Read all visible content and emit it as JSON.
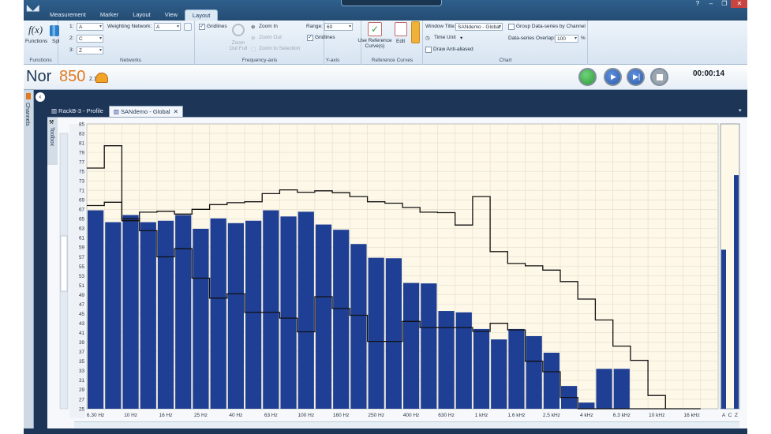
{
  "app": {
    "menu": [
      "Measurement",
      "Marker",
      "Layout",
      "View",
      "Layout"
    ],
    "active_menu_index": 4
  },
  "ribbon": {
    "functions": {
      "fx_label": "Functions",
      "spl_label": "Spl",
      "group_label": "Functions"
    },
    "networks": {
      "rows": [
        {
          "index": "1:",
          "value": "A"
        },
        {
          "index": "2:",
          "value": "C"
        },
        {
          "index": "3:",
          "value": "Z"
        }
      ],
      "weighting_label": "Weighting Network:",
      "weighting_value": "A",
      "group_label": "Networks"
    },
    "frequency_axis": {
      "gridlines_label": "Gridlines",
      "gridlines_checked": true,
      "zoom_out_full": "Zoom Out Full",
      "zoom_in": "Zoom In",
      "zoom_out": "Zoom Out",
      "zoom_to_selection": "Zoom to Selection",
      "group_label": "Frequency-axis"
    },
    "y_axis": {
      "range_label": "Range:",
      "range_value": "60",
      "gridlines_label": "Gridlines",
      "gridlines_checked": true,
      "group_label": "Y-axis"
    },
    "reference_curves": {
      "use_label": "Use Reference Curve(s)",
      "edit_label": "Edit",
      "group_label": "Reference Curves"
    },
    "chart": {
      "window_title_label": "Window Title:",
      "window_title_value": "SANdemo - Global",
      "time_unit_label": "Time Unit",
      "anti_aliased_label": "Draw Anti-aliased",
      "anti_aliased_checked": false,
      "group_by_channel_label": "Group Data-series by Channel",
      "group_by_channel_checked": false,
      "overlap_label": "Data-series Overlap:",
      "overlap_value": "100",
      "overlap_unit": "%",
      "group_label": "Chart"
    }
  },
  "header": {
    "brand_name": "Nor",
    "brand_number": "850",
    "brand_version": "2.1",
    "elapsed": "00:00:14",
    "colors": {
      "record": "#2e9b3a",
      "control": "#2f5fa8"
    }
  },
  "sidebar": {
    "channels_label": "Channels",
    "toolbox_label": "Toolbox"
  },
  "tabs": [
    {
      "label": "RackB-3 - Profile",
      "active": false
    },
    {
      "label": "SANdemo - Global",
      "active": true
    }
  ],
  "colors": {
    "bar": "#1f3f94",
    "plot_background": "#fdf8e8",
    "grid": "#e4dccb"
  },
  "chart_data": {
    "type": "bar",
    "ylim": [
      25,
      85
    ],
    "yticks": [
      25,
      27,
      29,
      31,
      33,
      35,
      37,
      39,
      41,
      43,
      45,
      47,
      49,
      51,
      53,
      55,
      57,
      59,
      61,
      63,
      65,
      67,
      69,
      71,
      73,
      75,
      77,
      79,
      81,
      83,
      85
    ],
    "categories": [
      "6.30 Hz",
      "8 Hz",
      "10 Hz",
      "12.5 Hz",
      "16 Hz",
      "20 Hz",
      "25 Hz",
      "31.5 Hz",
      "40 Hz",
      "50 Hz",
      "63 Hz",
      "80 Hz",
      "100 Hz",
      "125 Hz",
      "160 Hz",
      "200 Hz",
      "250 Hz",
      "315 Hz",
      "400 Hz",
      "500 Hz",
      "630 Hz",
      "800 Hz",
      "1 kHz",
      "1.25 kHz",
      "1.6 kHz",
      "2 kHz",
      "2.5 kHz",
      "3.15 kHz",
      "4 kHz",
      "5 kHz",
      "6.3 kHz",
      "8 kHz",
      "10 kHz",
      "12.5 kHz",
      "16 kHz",
      "20 kHz"
    ],
    "x_tick_labels": [
      "6.30 Hz",
      "10 Hz",
      "16 Hz",
      "25 Hz",
      "40 Hz",
      "63 Hz",
      "100 Hz",
      "160 Hz",
      "250 Hz",
      "400 Hz",
      "630 Hz",
      "1 kHz",
      "1.6 kHz",
      "2.5 kHz",
      "4 kHz",
      "6.3 kHz",
      "10 kHz",
      "16 kHz"
    ],
    "series": [
      {
        "kind": "bar",
        "values": [
          66.8,
          64.3,
          65.8,
          64.3,
          64.6,
          65.8,
          62.9,
          65.1,
          64.1,
          64.6,
          66.8,
          65.5,
          66.5,
          63.8,
          62.7,
          59.7,
          56.8,
          56.7,
          51.5,
          51.4,
          45.6,
          45.3,
          41.8,
          39.6,
          41.8,
          40.3,
          36.8,
          29.8,
          26.3,
          33.4,
          33.4,
          null,
          null,
          null,
          null,
          null
        ]
      },
      {
        "kind": "line",
        "values": [
          75.7,
          80.4,
          64.6,
          66.4,
          66.6,
          66.0,
          67.0,
          68.0,
          68.4,
          68.6,
          70.3,
          71.1,
          70.6,
          70.9,
          70.5,
          69.7,
          68.6,
          68.3,
          67.4,
          66.4,
          66.3,
          63.7,
          69.7,
          58.1,
          55.6,
          55.1,
          54.2,
          51.8,
          48.1,
          43.7,
          38.2,
          35.2,
          27.8,
          25.0,
          25.0,
          null
        ]
      },
      {
        "kind": "line",
        "values": [
          67.8,
          68.5,
          65.0,
          62.5,
          57.0,
          58.7,
          52.5,
          48.3,
          49.2,
          45.3,
          45.3,
          44.1,
          41.2,
          48.6,
          46.1,
          44.7,
          39.2,
          39.2,
          43.4,
          42.1,
          42.1,
          42.1,
          41.3,
          43.0,
          41.6,
          35.0,
          32.8,
          27.4,
          25.0,
          25.0,
          25.0,
          25.0,
          25.0,
          null,
          null,
          null
        ]
      }
    ],
    "level_bars": {
      "categories": [
        "A",
        "C",
        "Z"
      ],
      "values": [
        58.5,
        null,
        74.2
      ]
    }
  }
}
